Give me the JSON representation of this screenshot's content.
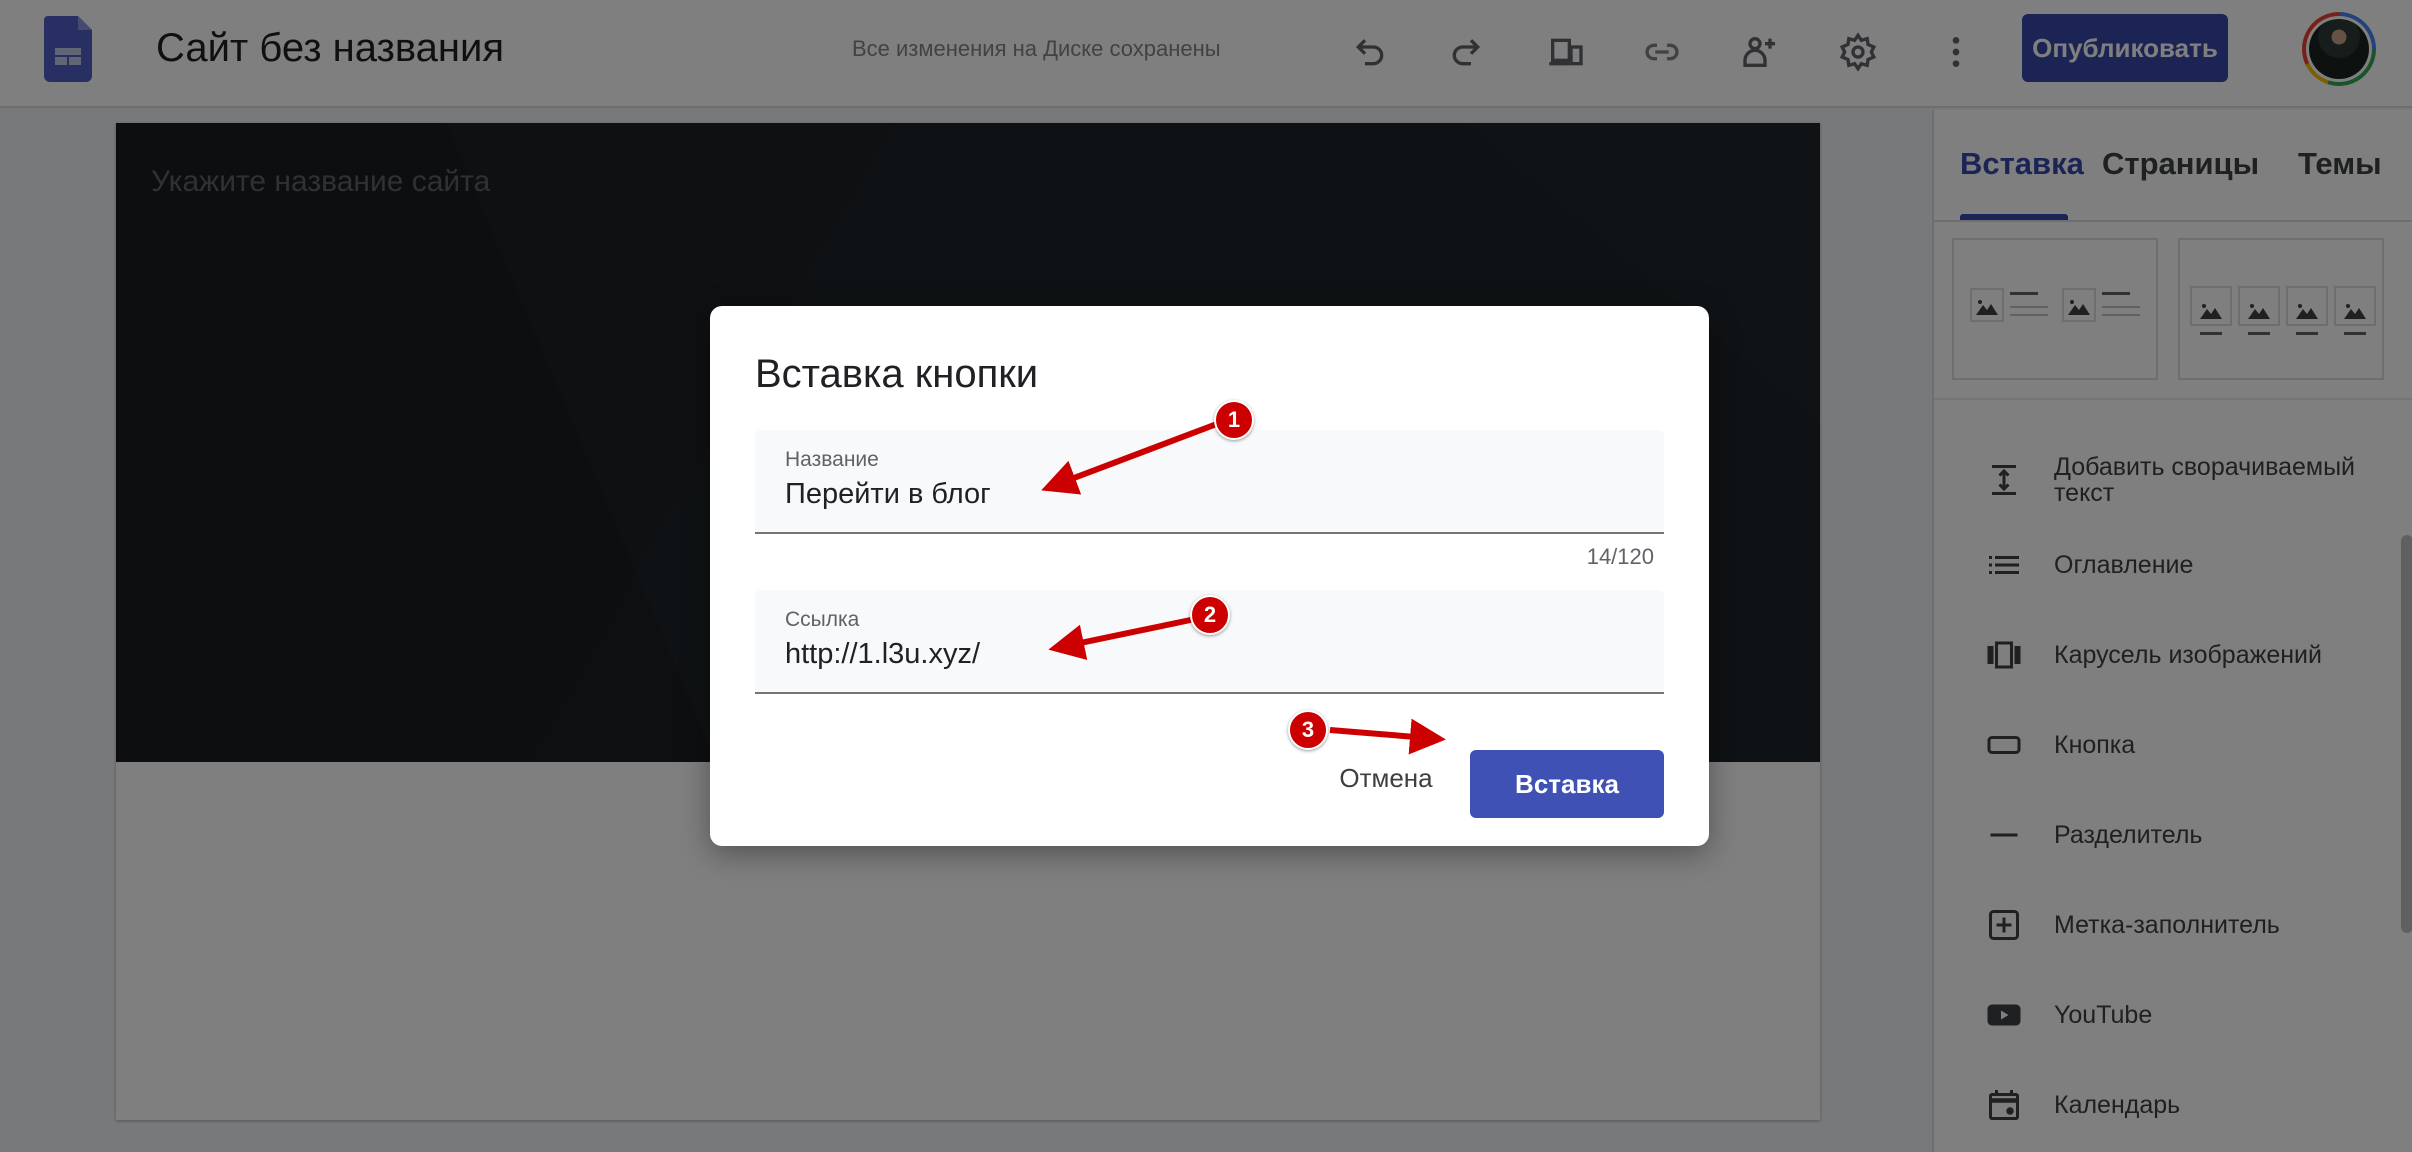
{
  "topbar": {
    "site_title": "Сайт без названия",
    "save_status": "Все изменения на Диске сохранены",
    "icons": [
      "undo-icon",
      "redo-icon",
      "preview-devices-icon",
      "link-icon",
      "share-add-person-icon",
      "settings-gear-icon",
      "more-vert-icon"
    ],
    "publish_label": "Опубликовать",
    "brand_color": "#3949ab"
  },
  "canvas": {
    "site_name_placeholder": "Укажите название сайта"
  },
  "sidebar": {
    "tabs": [
      {
        "label": "Вставка",
        "active": true
      },
      {
        "label": "Страницы",
        "active": false
      },
      {
        "label": "Темы",
        "active": false
      }
    ],
    "layouts": [
      "two-column-image-text-layout",
      "four-column-image-layout"
    ],
    "items": [
      {
        "label": "Добавить сворачиваемый текст",
        "icon": "collapsible-text-icon"
      },
      {
        "label": "Оглавление",
        "icon": "table-of-contents-icon"
      },
      {
        "label": "Карусель изображений",
        "icon": "image-carousel-icon"
      },
      {
        "label": "Кнопка",
        "icon": "button-icon"
      },
      {
        "label": "Разделитель",
        "icon": "divider-icon"
      },
      {
        "label": "Метка-заполнитель",
        "icon": "placeholder-icon"
      },
      {
        "label": "YouTube",
        "icon": "youtube-icon"
      },
      {
        "label": "Календарь",
        "icon": "calendar-icon"
      }
    ]
  },
  "dialog": {
    "title": "Вставка кнопки",
    "name_field": {
      "label": "Название",
      "value": "Перейти в блог",
      "counter": "14/120"
    },
    "link_field": {
      "label": "Ссылка",
      "value": "http://1.l3u.xyz/"
    },
    "cancel_label": "Отмена",
    "insert_label": "Вставка",
    "accent_color": "#3f51b5"
  },
  "annotations": [
    {
      "number": "1",
      "target": "name-field"
    },
    {
      "number": "2",
      "target": "link-field"
    },
    {
      "number": "3",
      "target": "insert-button"
    }
  ]
}
